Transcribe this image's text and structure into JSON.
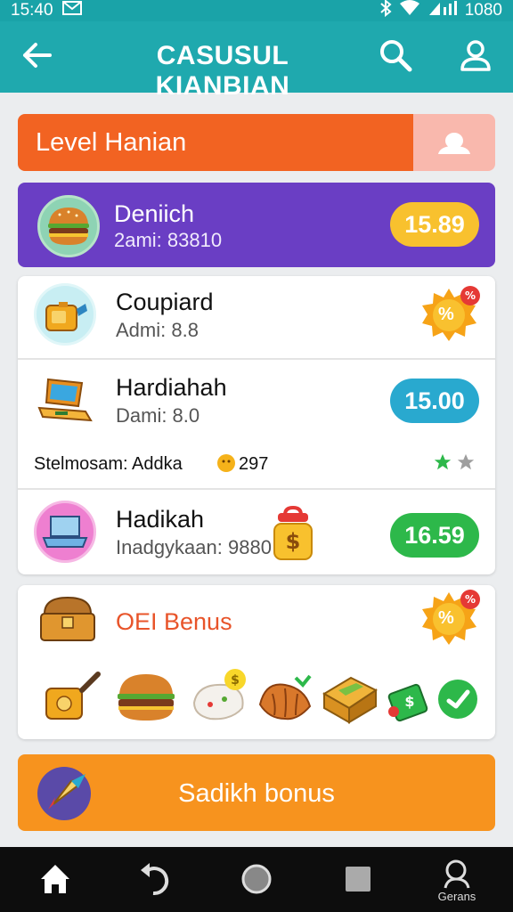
{
  "status": {
    "time": "15:40",
    "battery": "1080"
  },
  "header": {
    "title": "CASUSUL KIANBIAN"
  },
  "level": {
    "label": "Level Hanian",
    "progress": 0.83
  },
  "featured": {
    "name": "Deniich",
    "sub": "2ami: 83810",
    "price": "15.89",
    "icon": "burger-icon"
  },
  "items": [
    {
      "name": "Coupiard",
      "sub": "Admi: 8.8",
      "badge": "%",
      "icon": "mailbox-icon"
    },
    {
      "name": "Hardiahah",
      "sub": "Dami: 8.0",
      "price": "15.00",
      "icon": "laptop-icon"
    },
    {
      "name": "Hadikah",
      "sub": "Inadgykaan: 9880",
      "price": "16.59",
      "icon": "laptop-icon"
    }
  ],
  "rating_row": {
    "label": "Stelmosam: Addka",
    "count": "297"
  },
  "bonus": {
    "title": "OEI Benus",
    "badge": "%"
  },
  "cta": {
    "label": "Sadikh bonus"
  },
  "nav": {
    "search_label": "Gerans"
  },
  "colors": {
    "teal": "#1fa9ae",
    "orange": "#f26322",
    "purple": "#6a3ec4",
    "cyan_pill": "#29a9cf",
    "green_pill": "#2db84a",
    "yellow_pill": "#f8c12e",
    "cta": "#f7931e"
  }
}
